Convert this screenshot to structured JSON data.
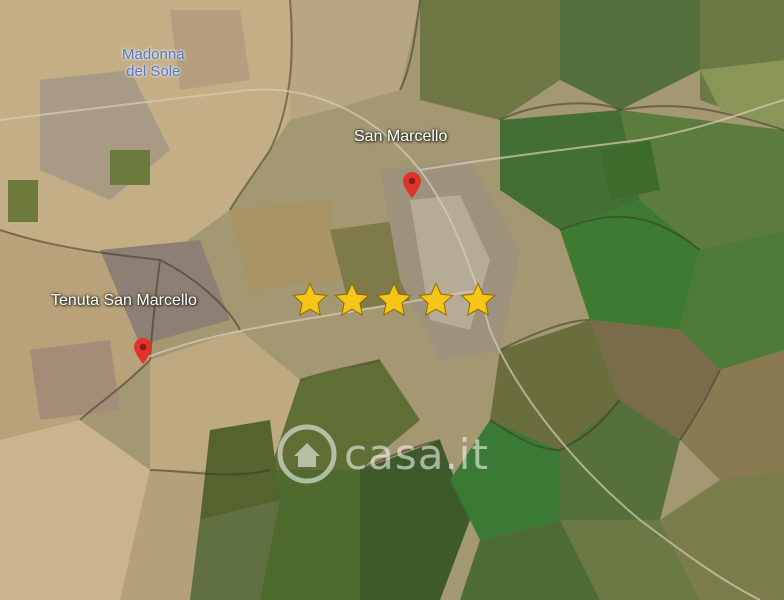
{
  "map": {
    "labels": {
      "madonna": {
        "line1": "Madonna",
        "line2": "del Sole"
      },
      "san_marcello": "San Marcello",
      "tenuta": "Tenuta San Marcello"
    },
    "rating": {
      "value": 5,
      "max": 5,
      "star_color": "#f5c518"
    },
    "watermark": {
      "text": "casa.it"
    },
    "pin_color": "#e0342b"
  }
}
